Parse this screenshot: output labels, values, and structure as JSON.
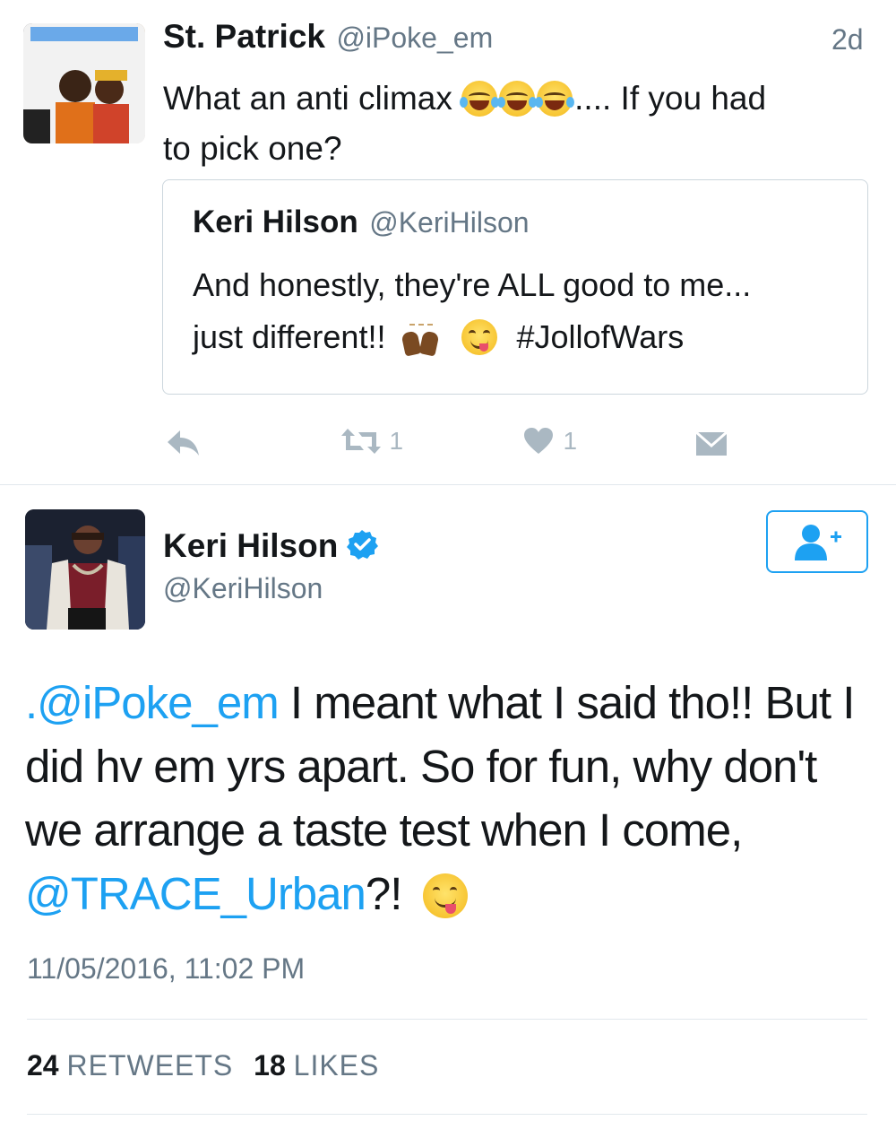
{
  "tweet": {
    "author_name": "St. Patrick",
    "author_handle": "@iPoke_em",
    "time": "2d",
    "text_before_emoji": "What an anti climax",
    "text_after_emoji": ".... If you had",
    "text_line2": "to pick one?",
    "quoted": {
      "author_name": "Keri Hilson",
      "author_handle": "@KeriHilson",
      "line1": "And honestly, they're ALL good to me...",
      "line2_before": "just different!!",
      "hashtag": "#JollofWars"
    },
    "actions": {
      "reply_icon": "reply-icon",
      "retweet_icon": "retweet-icon",
      "retweet_count": "1",
      "like_icon": "heart-icon",
      "like_count": "1",
      "dm_icon": "envelope-icon"
    }
  },
  "reply": {
    "author_name": "Keri Hilson",
    "author_handle": "@KeriHilson",
    "verified_icon": "verified-badge-icon",
    "follow_icon": "follow-user-icon",
    "mention_1": ".@iPoke_em",
    "text_1": " I meant what I said tho!! But I",
    "text_2": "did hv em yrs apart. So for fun, why don't",
    "text_3": "we arrange a taste test when I come,",
    "mention_2": "@TRACE_Urban",
    "text_4": "?!",
    "timestamp": "11/05/2016, 11:02 PM",
    "retweets_count": "24",
    "retweets_label": "RETWEETS",
    "likes_count": "18",
    "likes_label": "LIKES"
  },
  "colors": {
    "link": "#1da1f2",
    "muted": "#657786",
    "icon": "#aab8c2",
    "border": "#e1e8ed"
  }
}
